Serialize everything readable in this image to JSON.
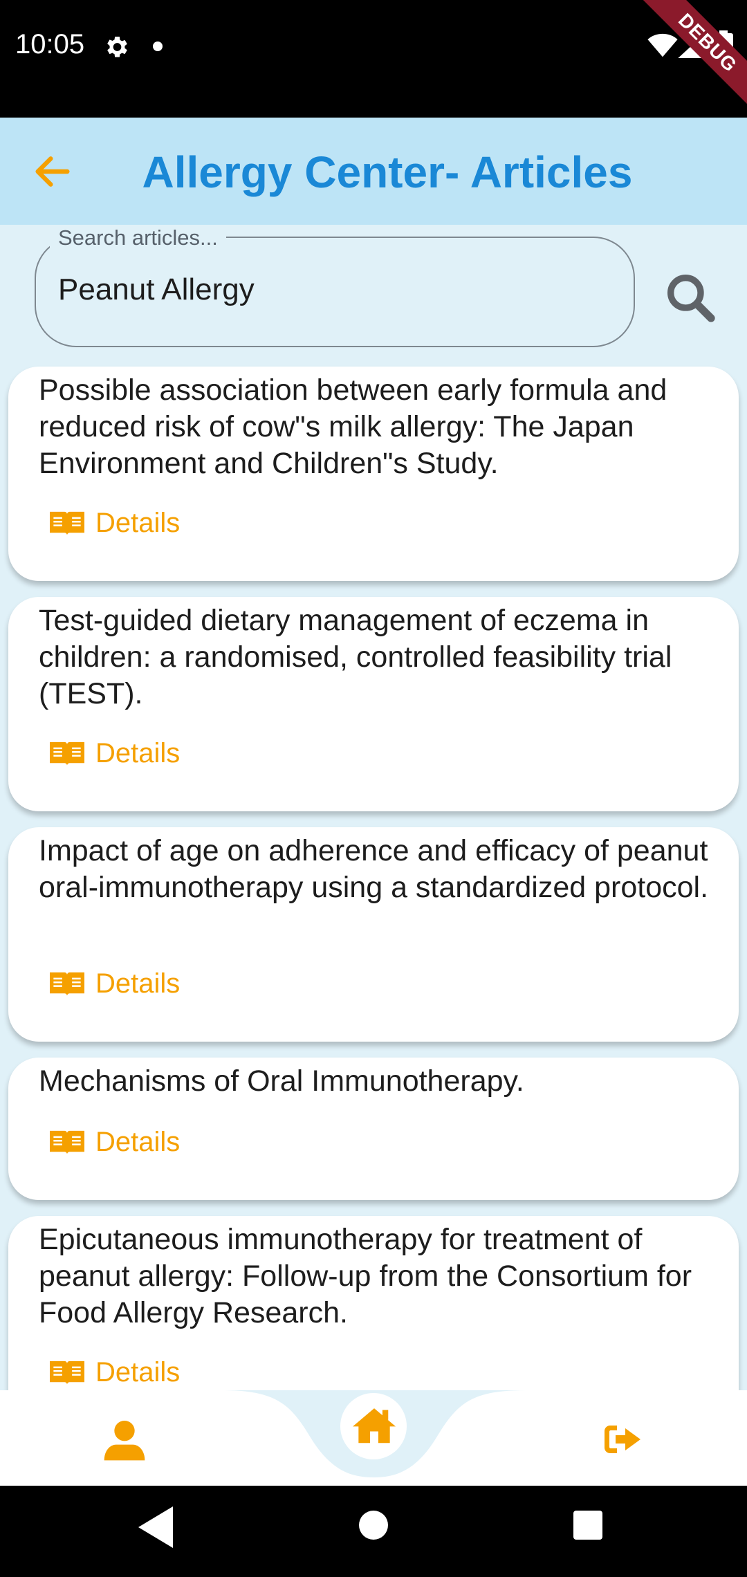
{
  "status": {
    "time": "10:05",
    "debug_label": "DEBUG"
  },
  "header": {
    "title": "Allergy Center- Articles",
    "back_icon": "arrow-left-icon",
    "accent_color": "#f5a000",
    "title_color": "#1a88d6"
  },
  "search": {
    "label": "Search articles...",
    "value": "Peanut Allergy",
    "button_icon": "search-icon"
  },
  "articles": [
    {
      "title": "Possible association between early formula and reduced risk of cow\"s milk allergy: The Japan Environment and Children\"s Study.",
      "details_label": "Details"
    },
    {
      "title": "Test-guided dietary management of eczema in children: a randomised, controlled feasibility trial (TEST).",
      "details_label": "Details"
    },
    {
      "title": "Impact of age on adherence and efficacy of peanut oral-immunotherapy using a standardized protocol.",
      "details_label": "Details"
    },
    {
      "title": "Mechanisms of Oral Immunotherapy.",
      "details_label": "Details"
    },
    {
      "title": "Epicutaneous immunotherapy for treatment of peanut allergy: Follow-up from the Consortium for Food Allergy Research.",
      "details_label": "Details"
    }
  ],
  "bottom_nav": {
    "items": [
      "person-icon",
      "home-icon",
      "logout-icon"
    ]
  }
}
